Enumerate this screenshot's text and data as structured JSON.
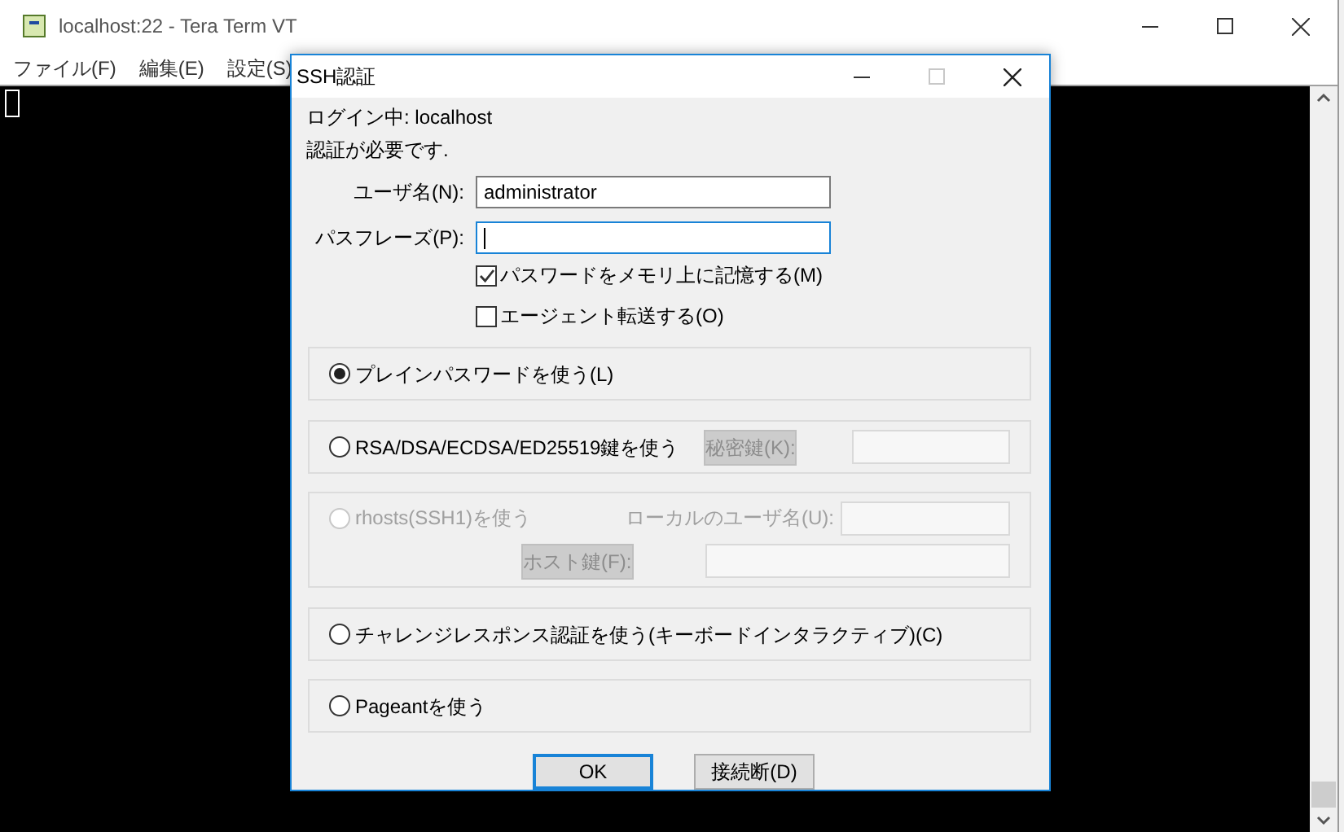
{
  "window": {
    "title": "localhost:22 - Tera Term VT"
  },
  "menu": [
    "ファイル(F)",
    "編集(E)",
    "設定(S)"
  ],
  "dialog": {
    "title": "SSH認証",
    "login": "ログイン中: localhost",
    "message": "認証が必要です.",
    "fields": [
      {
        "label": "ユーザ名(N):",
        "value": "administrator",
        "focused": false
      },
      {
        "label": "パスフレーズ(P):",
        "focused": true
      }
    ],
    "checkboxes": [
      {
        "label": "パスワードをメモリ上に記憶する(M)",
        "checked": true
      },
      {
        "label": "エージェント転送する(O)",
        "checked": false
      }
    ],
    "methods": [
      {
        "kind": "plain",
        "label": "プレインパスワードを使う(L)",
        "selected": true,
        "disabled": false
      },
      {
        "kind": "key",
        "label": "RSA/DSA/ECDSA/ED25519鍵を使う",
        "selected": false,
        "disabled": false,
        "key_button": {
          "label": "秘密鍵(K):",
          "disabled": true
        }
      },
      {
        "kind": "rhosts",
        "label": "rhosts(SSH1)を使う",
        "selected": false,
        "disabled": true,
        "user_label": "ローカルのユーザ名(U):",
        "host_key_button": {
          "label": "ホスト鍵(F):",
          "disabled": true
        }
      },
      {
        "kind": "plain",
        "label": "チャレンジレスポンス認証を使う(キーボードインタラクティブ)(C)",
        "selected": false,
        "disabled": false
      },
      {
        "kind": "plain",
        "label": "Pageantを使う",
        "selected": false,
        "disabled": false
      }
    ],
    "buttons": [
      {
        "label": "OK",
        "default": true
      },
      {
        "label": "接続断(D)",
        "default": false
      }
    ]
  }
}
